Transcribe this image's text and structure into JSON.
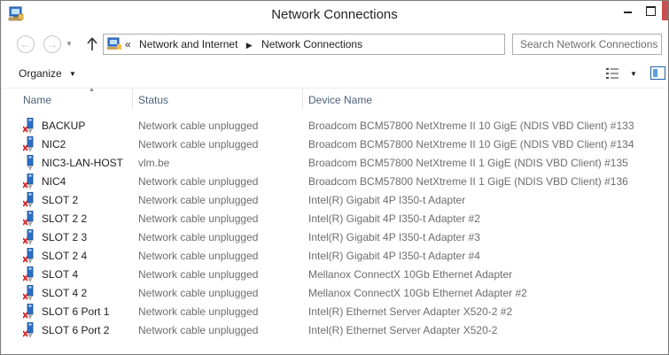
{
  "window": {
    "title": "Network Connections"
  },
  "navigation": {
    "breadcrumb_overflow": "«",
    "breadcrumb": [
      "Network and Internet",
      "Network Connections"
    ],
    "search_placeholder": "Search Network Connections"
  },
  "toolbar": {
    "organize_label": "Organize"
  },
  "columns": {
    "name": "Name",
    "status": "Status",
    "device": "Device Name"
  },
  "connections": [
    {
      "name": "BACKUP",
      "status": "Network cable unplugged",
      "device": "Broadcom BCM57800 NetXtreme II 10 GigE (NDIS VBD Client) #133",
      "connected": false
    },
    {
      "name": "NIC2",
      "status": "Network cable unplugged",
      "device": "Broadcom BCM57800 NetXtreme II 10 GigE (NDIS VBD Client) #134",
      "connected": false
    },
    {
      "name": "NIC3-LAN-HOST",
      "status": "vlm.be",
      "device": "Broadcom BCM57800 NetXtreme II 1 GigE (NDIS VBD Client) #135",
      "connected": true
    },
    {
      "name": "NIC4",
      "status": "Network cable unplugged",
      "device": "Broadcom BCM57800 NetXtreme II 1 GigE (NDIS VBD Client) #136",
      "connected": false
    },
    {
      "name": "SLOT 2",
      "status": "Network cable unplugged",
      "device": "Intel(R) Gigabit 4P I350-t Adapter",
      "connected": false
    },
    {
      "name": "SLOT 2 2",
      "status": "Network cable unplugged",
      "device": "Intel(R) Gigabit 4P I350-t Adapter #2",
      "connected": false
    },
    {
      "name": "SLOT 2 3",
      "status": "Network cable unplugged",
      "device": "Intel(R) Gigabit 4P I350-t Adapter #3",
      "connected": false
    },
    {
      "name": "SLOT 2 4",
      "status": "Network cable unplugged",
      "device": "Intel(R) Gigabit 4P I350-t Adapter #4",
      "connected": false
    },
    {
      "name": "SLOT 4",
      "status": "Network cable unplugged",
      "device": "Mellanox ConnectX 10Gb Ethernet Adapter",
      "connected": false
    },
    {
      "name": "SLOT 4 2",
      "status": "Network cable unplugged",
      "device": "Mellanox ConnectX 10Gb Ethernet Adapter #2",
      "connected": false
    },
    {
      "name": "SLOT 6 Port 1",
      "status": "Network cable unplugged",
      "device": "Intel(R) Ethernet Server Adapter X520-2 #2",
      "connected": false
    },
    {
      "name": "SLOT 6 Port 2",
      "status": "Network cable unplugged",
      "device": "Intel(R) Ethernet Server Adapter X520-2",
      "connected": false
    }
  ],
  "icons": {
    "app": "network-connections-icon",
    "adapter": "network-adapter-icon",
    "unplugged_marker": "red-x-icon"
  },
  "colors": {
    "close_button": "#c75050",
    "header_text": "#4c607a",
    "unplugged_x": "#d3272a",
    "adapter_blue": "#2a6fc9"
  }
}
